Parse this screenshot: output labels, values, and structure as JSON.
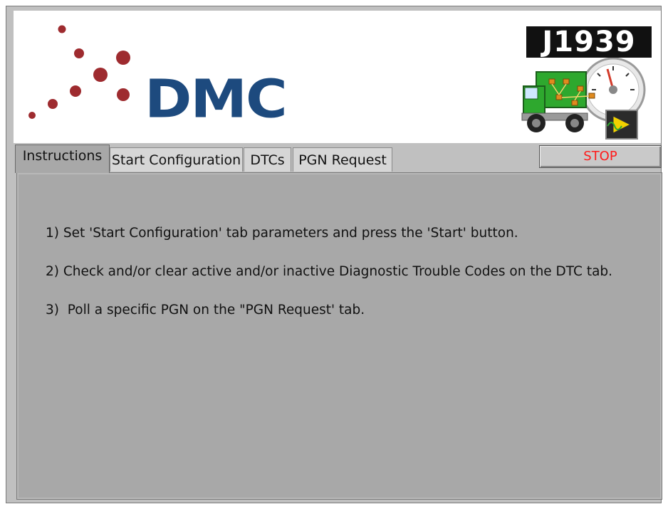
{
  "logo": {
    "company": "DMC",
    "product_badge": "J1939",
    "brand_color": "#1d4a7e",
    "dot_color": "#9e2b2f"
  },
  "tabs": [
    {
      "label": "Instructions",
      "active": true
    },
    {
      "label": "Start Configuration",
      "active": false
    },
    {
      "label": "DTCs",
      "active": false
    },
    {
      "label": "PGN Request",
      "active": false
    }
  ],
  "stop_button": {
    "label": "STOP",
    "color": "#ff1a1a"
  },
  "instructions": [
    "1) Set 'Start Configuration' tab parameters and press the 'Start' button.",
    "2) Check and/or clear active and/or inactive Diagnostic Trouble Codes on the DTC tab.",
    "3)  Poll a specific PGN on the \"PGN Request' tab."
  ],
  "icons": {
    "truck": "truck-gauge-icon",
    "labview": "labview-icon"
  }
}
